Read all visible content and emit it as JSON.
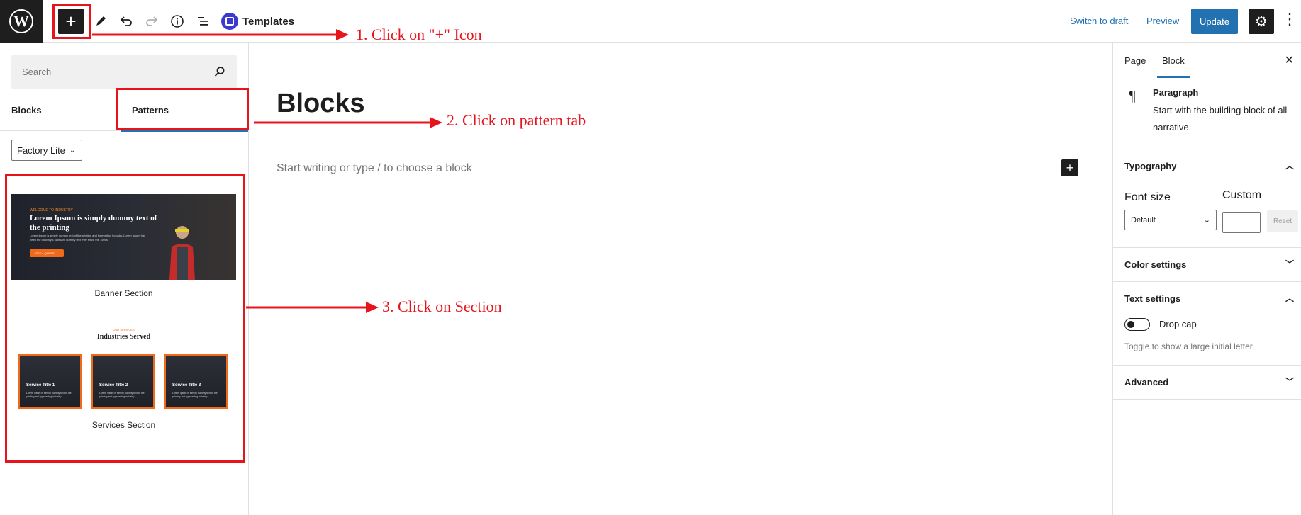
{
  "topbar": {
    "templates_label": "Templates",
    "switch_to_draft": "Switch to draft",
    "preview": "Preview",
    "update": "Update"
  },
  "inserter": {
    "search_placeholder": "Search",
    "tabs": {
      "blocks": "Blocks",
      "patterns": "Patterns"
    },
    "category": "Factory Lite",
    "patterns": [
      {
        "label": "Banner Section",
        "kicker": "WELCOME TO INDUSTRY",
        "headline": "Lorem Ipsum is simply dummy text of the printing",
        "sub": "Lorem Ipsum is simply dummy text of the printing and typesetting industry. Lorem Ipsum has been the industry's standard dummy text ever since the 1500s",
        "cta": "GET A QUOTE →"
      },
      {
        "label": "Services Section",
        "kicker": "OUR SERVICES",
        "title": "Industries Served",
        "cards": [
          {
            "title": "Service Title 1",
            "desc": "Lorem Ipsum is simply dummy text of the printing and typesetting industry."
          },
          {
            "title": "Service Title 2",
            "desc": "Lorem Ipsum is simply dummy text of the printing and typesetting industry."
          },
          {
            "title": "Service Title 3",
            "desc": "Lorem Ipsum is simply dummy text of the printing and typesetting industry."
          }
        ]
      }
    ]
  },
  "editor": {
    "title": "Blocks",
    "placeholder": "Start writing or type / to choose a block"
  },
  "sidebar": {
    "tabs": {
      "page": "Page",
      "block": "Block"
    },
    "block_name": "Paragraph",
    "block_desc": "Start with the building block of all narrative.",
    "typography": {
      "title": "Typography",
      "font_size_label": "Font size",
      "custom_label": "Custom",
      "font_size_value": "Default",
      "reset": "Reset"
    },
    "color_settings": "Color settings",
    "text_settings": {
      "title": "Text settings",
      "drop_cap": "Drop cap",
      "help": "Toggle to show a large initial letter."
    },
    "advanced": "Advanced"
  },
  "annotations": {
    "step1": "1. Click on \"+\" Icon",
    "step2": "2. Click on pattern tab",
    "step3": "3. Click on Section",
    "color": "#e8141c"
  }
}
